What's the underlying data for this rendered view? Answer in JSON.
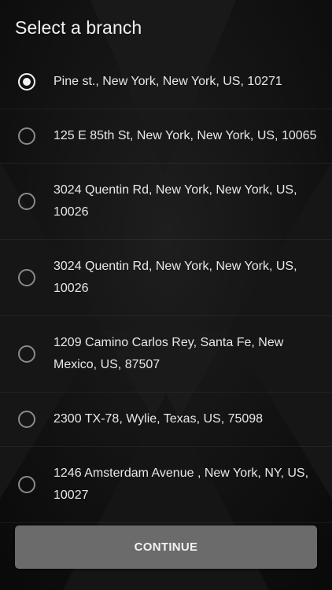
{
  "header": {
    "title": "Select a branch"
  },
  "branches": [
    {
      "address": "Pine st., New York, New York, US, 10271",
      "selected": true
    },
    {
      "address": "125 E 85th St, New York, New York, US, 10065",
      "selected": false
    },
    {
      "address": "3024 Quentin Rd, New York, New York, US, 10026",
      "selected": false
    },
    {
      "address": "3024 Quentin Rd, New York, New York, US, 10026",
      "selected": false
    },
    {
      "address": "1209 Camino Carlos Rey, Santa Fe, New Mexico, US, 87507",
      "selected": false
    },
    {
      "address": "2300 TX-78, Wylie, Texas, US, 75098",
      "selected": false
    },
    {
      "address": "1246 Amsterdam Avenue , New York, NY, US, 10027",
      "selected": false
    }
  ],
  "footer": {
    "continue_label": "CONTINUE"
  },
  "colors": {
    "background": "#0f0f0f",
    "text": "#e8e8e8",
    "radio_selected": "#f4f4f4",
    "radio_unselected": "#8a8a8a",
    "button_background": "#6b6b6b"
  },
  "icons": {
    "selected": "radio-checked-icon",
    "unselected": "radio-unchecked-icon"
  }
}
